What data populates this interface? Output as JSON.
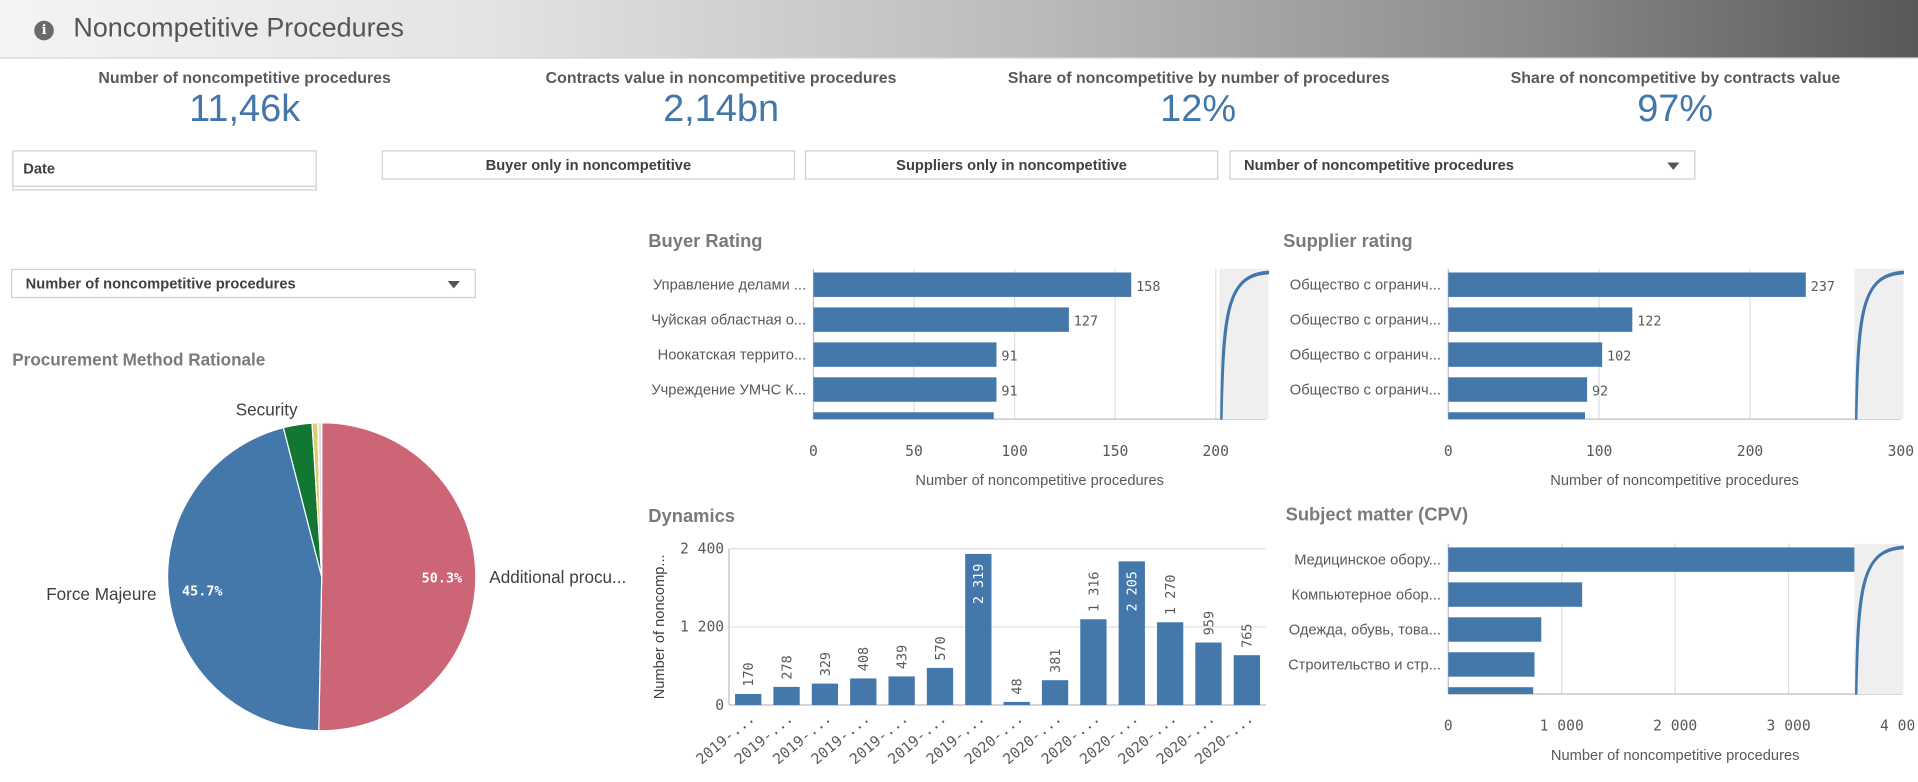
{
  "header": {
    "title": "Noncompetitive Procedures",
    "info_icon": "info-icon"
  },
  "kpis": [
    {
      "label": "Number of noncompetitive procedures",
      "value": "11,46k"
    },
    {
      "label": "Contracts value in noncompetitive procedures",
      "value": "2,14bn"
    },
    {
      "label": "Share of noncompetitive by number of procedures",
      "value": "12%"
    },
    {
      "label": "Share of noncompetitive by contracts value",
      "value": "97%"
    }
  ],
  "filters": {
    "date_label": "Date",
    "buyer_only": "Buyer only in noncompetitive",
    "suppliers_only": "Suppliers only in noncompetitive",
    "measure_select": "Number of noncompetitive procedures",
    "measure_select_left": "Number of noncompetitive procedures"
  },
  "colors": {
    "accent": "#4477aa",
    "pink": "#cc6677",
    "green": "#117733",
    "yellow": "#ddcc77"
  },
  "chart_data": [
    {
      "id": "buyer",
      "type": "bar",
      "orientation": "horizontal",
      "title": "Buyer Rating",
      "xlabel": "Number of noncompetitive procedures",
      "categories": [
        "Управление делами ...",
        "Чуйская областная о...",
        "Ноокатская террито...",
        "Учреждение УМЧС К..."
      ],
      "values": [
        158,
        127,
        91,
        91
      ],
      "xlim": [
        0,
        225
      ],
      "ticks": [
        0,
        50,
        100,
        150,
        200
      ],
      "tick_labels": [
        "0",
        "50",
        "100",
        "150",
        "200"
      ]
    },
    {
      "id": "supplier",
      "type": "bar",
      "orientation": "horizontal",
      "title": "Supplier rating",
      "xlabel": "Number of noncompetitive procedures",
      "categories": [
        "Общество с огранич...",
        "Общество с огранич...",
        "Общество с огранич...",
        "Общество с огранич..."
      ],
      "values": [
        237,
        122,
        102,
        92
      ],
      "xlim": [
        0,
        300
      ],
      "ticks": [
        0,
        100,
        200,
        300
      ],
      "tick_labels": [
        "0",
        "100",
        "200",
        "300"
      ]
    },
    {
      "id": "cpv",
      "type": "bar",
      "orientation": "horizontal",
      "title": "Subject matter (CPV)",
      "xlabel": "Number of noncompetitive procedures",
      "categories": [
        "Медицинское обору...",
        "Компьютерное обор...",
        "Одежда, обувь, това...",
        "Строительство и стр..."
      ],
      "values": [
        3620,
        1180,
        820,
        760
      ],
      "xlim": [
        0,
        4000
      ],
      "ticks": [
        0,
        1000,
        2000,
        3000,
        4000
      ],
      "tick_labels": [
        "0",
        "1 000",
        "2 000",
        "3 000",
        "4 000"
      ]
    },
    {
      "id": "dynamics",
      "type": "bar",
      "title": "Dynamics",
      "ylabel": "Number of noncomp...",
      "categories": [
        "2019-...",
        "2019-...",
        "2019-...",
        "2019-...",
        "2019-...",
        "2019-...",
        "2019-...",
        "2020-...",
        "2020-...",
        "2020-...",
        "2020-...",
        "2020-...",
        "2020-...",
        "2020-..."
      ],
      "values": [
        170,
        278,
        329,
        408,
        439,
        570,
        2319,
        48,
        381,
        1316,
        2205,
        1270,
        959,
        765
      ],
      "value_labels": [
        "170",
        "278",
        "329",
        "408",
        "439",
        "570",
        "2 319",
        "48",
        "381",
        "1 316",
        "2 205",
        "1 270",
        "959",
        "765"
      ],
      "ylim": [
        0,
        2400
      ],
      "ticks": [
        0,
        1200,
        2400
      ],
      "tick_labels": [
        "0",
        "1 200",
        "2 400"
      ]
    },
    {
      "id": "rationale",
      "type": "pie",
      "title": "Procurement Method Rationale",
      "labels": [
        "Additional procu...",
        "Force Majeure",
        "Security",
        "",
        ""
      ],
      "values": [
        50.3,
        45.7,
        3.0,
        0.6,
        0.4
      ],
      "value_labels": [
        "50.3%",
        "45.7%",
        "",
        "",
        ""
      ],
      "colors": [
        "#cc6677",
        "#4477aa",
        "#117733",
        "#ddcc77",
        "#e0e0e0"
      ]
    }
  ]
}
